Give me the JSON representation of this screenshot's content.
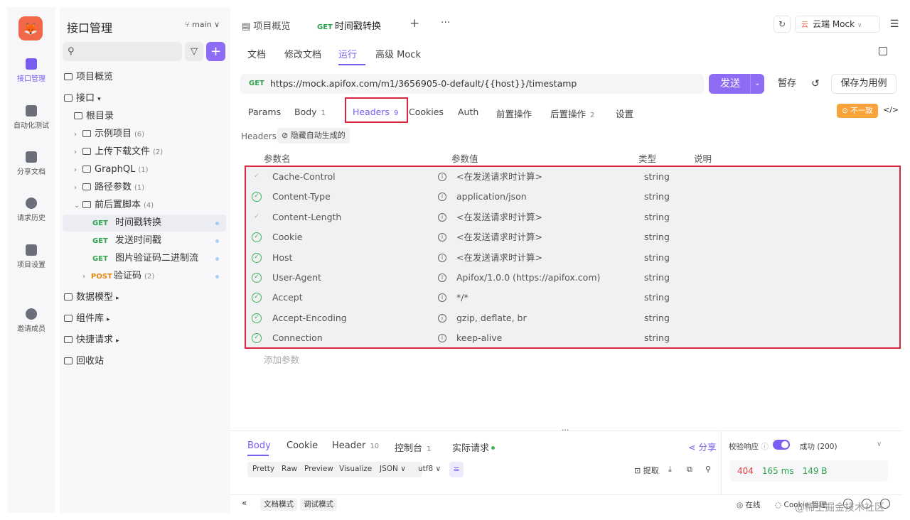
{
  "rail": {
    "logo": "🦊",
    "items": [
      {
        "label": "接口管理",
        "icon": "api-icon",
        "active": true
      },
      {
        "label": "自动化测试",
        "icon": "test-icon"
      },
      {
        "label": "分享文档",
        "icon": "doc-share-icon"
      },
      {
        "label": "请求历史",
        "icon": "history-icon"
      },
      {
        "label": "项目设置",
        "icon": "settings-icon"
      },
      {
        "label": "邀请成员",
        "icon": "invite-icon"
      }
    ]
  },
  "sidebar": {
    "title": "接口管理",
    "branch": "main",
    "search_placeholder": "",
    "overview": "项目概览",
    "api_root": "接口",
    "root_dir": "根目录",
    "folders": [
      {
        "label": "示例项目",
        "count": "(6)"
      },
      {
        "label": "上传下载文件",
        "count": "(2)"
      },
      {
        "label": "GraphQL",
        "count": "(1)"
      },
      {
        "label": "路径参数",
        "count": "(1)"
      },
      {
        "label": "前后置脚本",
        "count": "(4)"
      }
    ],
    "endpoints": [
      {
        "method": "GET",
        "label": "时间戳转换"
      },
      {
        "method": "GET",
        "label": "发送时间戳"
      },
      {
        "method": "GET",
        "label": "图片验证码二进制流"
      }
    ],
    "post_folder": {
      "method": "POST",
      "label": "验证码",
      "count": "(2)"
    },
    "sections": [
      "数据模型",
      "组件库",
      "快捷请求"
    ],
    "trash": "回收站"
  },
  "tabs": {
    "overview": "项目概览",
    "active_method": "GET",
    "active_label": "时间戳转换",
    "env": "云端 Mock"
  },
  "subtabs": [
    "文档",
    "修改文档",
    "运行",
    "高级 Mock"
  ],
  "request": {
    "method": "GET",
    "url": "https://mock.apifox.com/m1/3656905-0-default/{{host}}/timestamp",
    "send": "发送",
    "save": "暂存",
    "save_as": "保存为用例"
  },
  "param_tabs": [
    {
      "label": "Params",
      "n": ""
    },
    {
      "label": "Body",
      "n": "1"
    },
    {
      "label": "Headers",
      "n": "9"
    },
    {
      "label": "Cookies",
      "n": ""
    },
    {
      "label": "Auth",
      "n": ""
    },
    {
      "label": "前置操作",
      "n": ""
    },
    {
      "label": "后置操作",
      "n": "2"
    },
    {
      "label": "设置",
      "n": ""
    }
  ],
  "diff_badge": "⊙ 不一致",
  "headers": {
    "label": "Headers",
    "hide_auto": "隐藏自动生成的",
    "columns": {
      "name": "参数名",
      "value": "参数值",
      "type": "类型",
      "desc": "说明"
    },
    "rows": [
      {
        "name": "Cache-Control",
        "value": "<在发送请求时计算>",
        "type": "string",
        "checked": false
      },
      {
        "name": "Content-Type",
        "value": "application/json",
        "type": "string",
        "checked": true
      },
      {
        "name": "Content-Length",
        "value": "<在发送请求时计算>",
        "type": "string",
        "checked": false
      },
      {
        "name": "Cookie",
        "value": "<在发送请求时计算>",
        "type": "string",
        "checked": true
      },
      {
        "name": "Host",
        "value": "<在发送请求时计算>",
        "type": "string",
        "checked": true
      },
      {
        "name": "User-Agent",
        "value": "Apifox/1.0.0 (https://apifox.com)",
        "type": "string",
        "checked": true
      },
      {
        "name": "Accept",
        "value": "*/*",
        "type": "string",
        "checked": true
      },
      {
        "name": "Accept-Encoding",
        "value": "gzip, deflate, br",
        "type": "string",
        "checked": true
      },
      {
        "name": "Connection",
        "value": "keep-alive",
        "type": "string",
        "checked": true
      }
    ],
    "add_param": "添加参数"
  },
  "response": {
    "tabs": [
      {
        "label": "Body",
        "n": ""
      },
      {
        "label": "Cookie",
        "n": ""
      },
      {
        "label": "Header",
        "n": "10"
      },
      {
        "label": "控制台",
        "n": "1"
      },
      {
        "label": "实际请求",
        "n": ""
      }
    ],
    "share": "分享",
    "formats": [
      "Pretty",
      "Raw",
      "Preview",
      "Visualize",
      "JSON ∨",
      "utf8 ∨"
    ],
    "extract": "提取",
    "validate_label": "校验响应",
    "status_text": "成功 (200)",
    "code": "404",
    "time": "165 ms",
    "size": "149 B"
  },
  "footer": {
    "doc_mode": "文档模式",
    "debug_mode": "调试模式",
    "online": "在线",
    "cookie_mgmt": "Cookie 管理",
    "watermark": "@稀土掘金技术社区"
  }
}
